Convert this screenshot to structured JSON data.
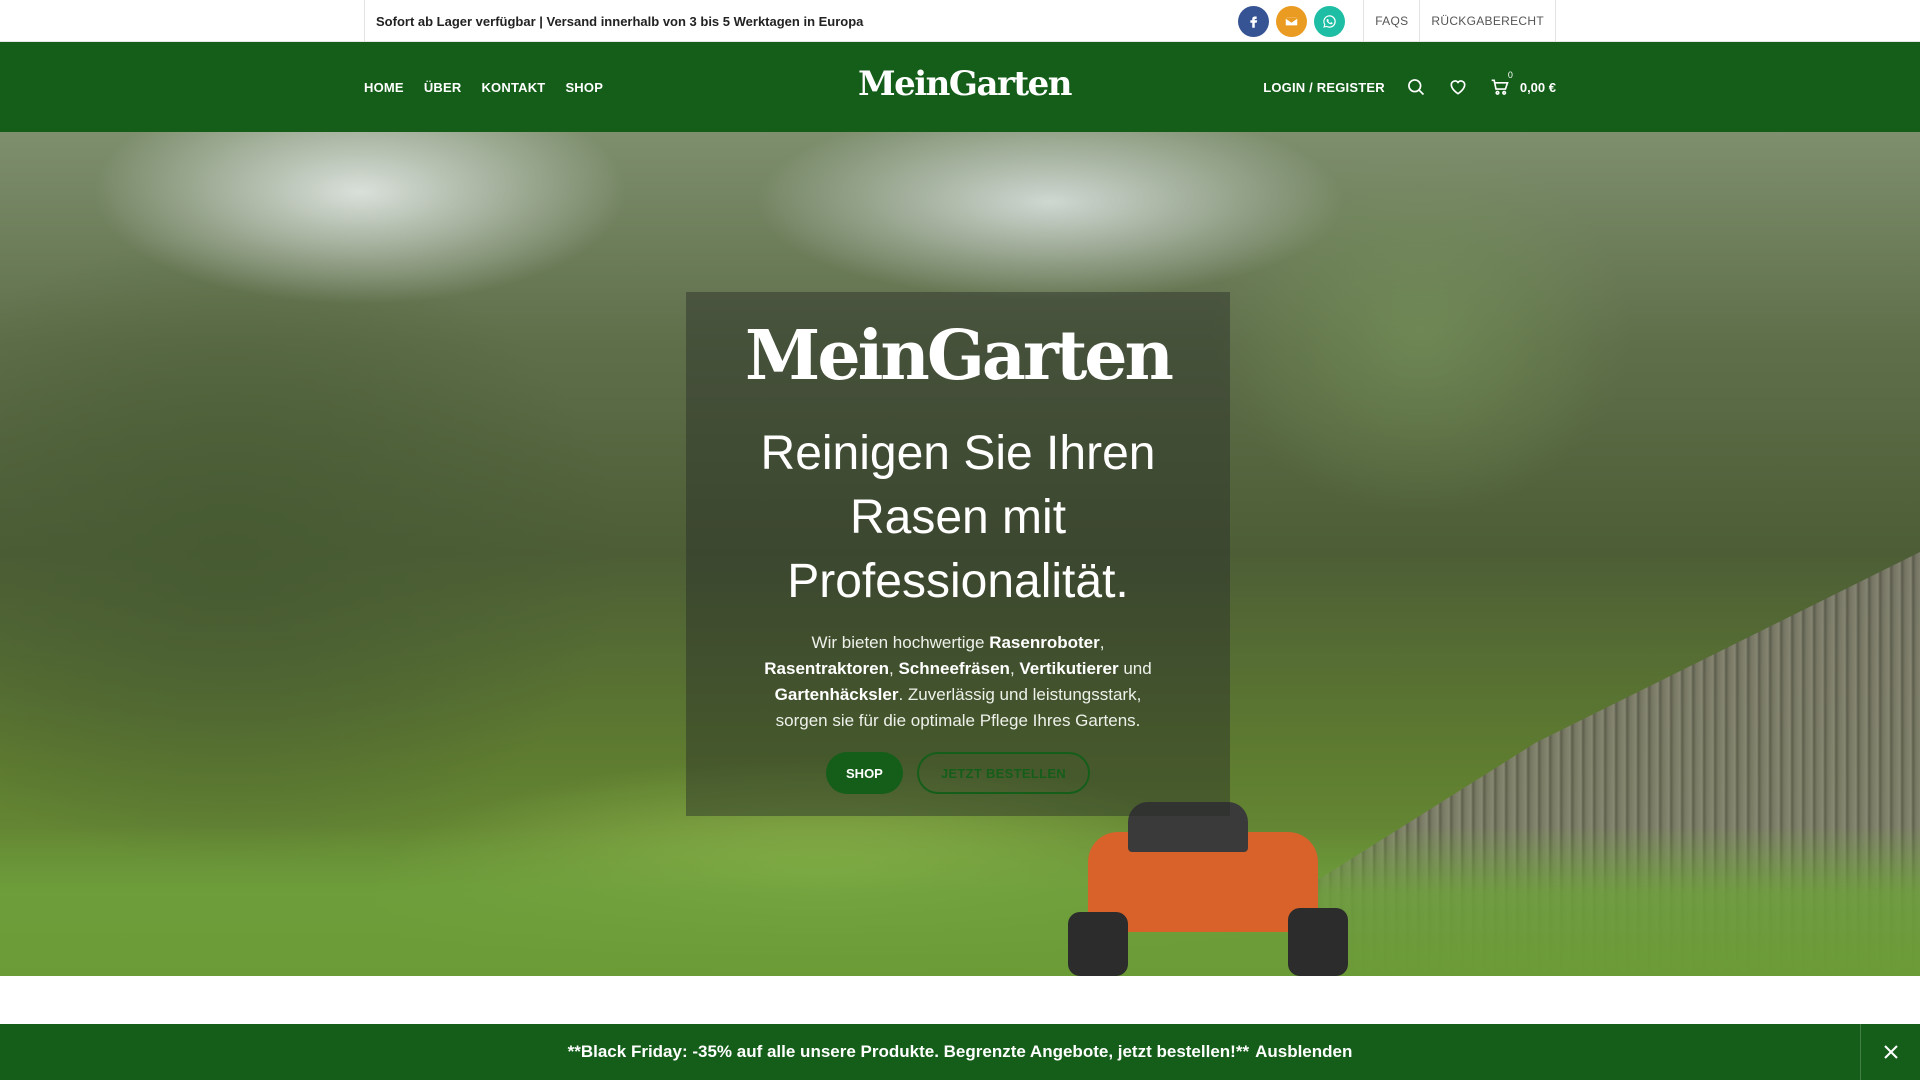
{
  "topbar": {
    "text": "Sofort ab Lager verfügbar | Versand innerhalb von 3 bis 5 Werktagen in Europa",
    "links": [
      "FAQS",
      "RÜCKGABERECHT"
    ],
    "social": [
      {
        "icon": "facebook-icon",
        "color": "#365493"
      },
      {
        "icon": "mail-icon",
        "color": "#ea9b21"
      },
      {
        "icon": "whatsapp-icon",
        "color": "#1ebea5"
      }
    ]
  },
  "header": {
    "nav": [
      "HOME",
      "ÜBER",
      "KONTAKT",
      "SHOP"
    ],
    "logo": "MeinGarten",
    "login": "LOGIN / REGISTER",
    "cart_count": "0",
    "cart_total": "0,00 €",
    "brand_color": "#155e1a"
  },
  "hero": {
    "logo": "MeinGarten",
    "title": "Reinigen Sie Ihren Rasen mit Professionalität.",
    "desc_parts": {
      "p1": "Wir bieten hochwertige ",
      "b1": "Rasenroboter",
      "p2": ", ",
      "b2": "Rasentraktoren",
      "p3": ", ",
      "b3": "Schneefräsen",
      "p4": ", ",
      "b4": "Vertikutierer",
      "p5": " und ",
      "b5": "Gartenhäcksler",
      "p6": ". Zuverlässig und leistungsstark, sorgen sie für die optimale Pflege Ihres Gartens."
    },
    "btn_shop": "SHOP",
    "btn_order": "JETZT BESTELLEN"
  },
  "promo": {
    "text": "**Black Friday: -35% auf alle unsere Produkte. Begrenzte Angebote, jetzt bestellen!**",
    "hide": "Ausblenden"
  }
}
